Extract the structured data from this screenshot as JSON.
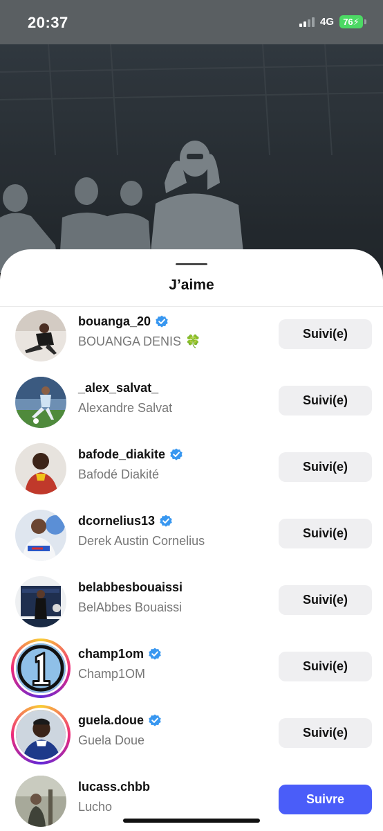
{
  "status_bar": {
    "time": "20:37",
    "network": "4G",
    "battery": "76"
  },
  "sheet": {
    "title": "J’aime"
  },
  "users": [
    {
      "username": "bouanga_20",
      "full_name": "BOUANGA DENIS",
      "emoji": "🍀",
      "verified": true,
      "story": false,
      "button": "Suivi(e)",
      "following": true,
      "avatar_icon": "player-photo"
    },
    {
      "username": "_alex_salvat_",
      "full_name": "Alexandre Salvat",
      "verified": false,
      "story": false,
      "button": "Suivi(e)",
      "following": true,
      "avatar_icon": "player-photo"
    },
    {
      "username": "bafode_diakite",
      "full_name": "Bafodé Diakité",
      "verified": true,
      "story": false,
      "button": "Suivi(e)",
      "following": true,
      "avatar_icon": "player-photo"
    },
    {
      "username": "dcornelius13",
      "full_name": "Derek Austin Cornelius",
      "verified": true,
      "story": false,
      "button": "Suivi(e)",
      "following": true,
      "avatar_icon": "player-photo"
    },
    {
      "username": "belabbesbouaissi",
      "full_name": "BelAbbes Bouaissi",
      "verified": false,
      "story": false,
      "button": "Suivi(e)",
      "following": true,
      "avatar_icon": "person-photo"
    },
    {
      "username": "champ1om",
      "full_name": "Champ1OM",
      "verified": true,
      "story": true,
      "button": "Suivi(e)",
      "following": true,
      "avatar_icon": "number-one-logo"
    },
    {
      "username": "guela.doue",
      "full_name": "Guela Doue",
      "verified": true,
      "story": true,
      "button": "Suivi(e)",
      "following": true,
      "avatar_icon": "player-photo"
    },
    {
      "username": "lucass.chbb",
      "full_name": "Lucho",
      "verified": false,
      "story": false,
      "button": "Suivre",
      "following": false,
      "avatar_icon": "person-photo"
    }
  ],
  "colors": {
    "follow_button": "#4a5df9",
    "following_button": "#efeff1",
    "verified_badge": "#3897f0"
  }
}
